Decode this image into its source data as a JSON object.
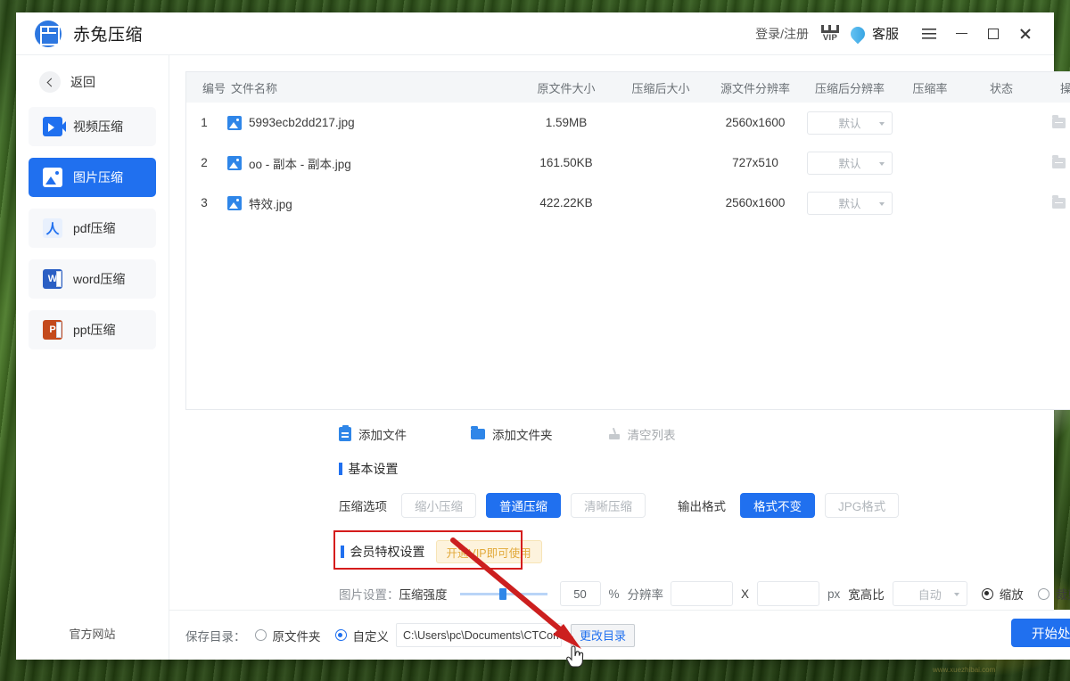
{
  "app": {
    "name": "赤兔压缩",
    "logo_icon": "grid-logo-icon"
  },
  "titlebar": {
    "login": "登录/注册",
    "vip_label": "VIP",
    "vip_icon": "crown-vip-icon",
    "support": "客服",
    "support_icon": "headset-drop-icon",
    "menu_icon": "hamburger-menu-icon",
    "minimize_icon": "minimize-icon",
    "maximize_icon": "maximize-icon",
    "close_icon": "close-icon"
  },
  "sidebar": {
    "back": "返回",
    "back_icon": "chevron-left-icon",
    "items": [
      {
        "label": "视频压缩",
        "icon": "video-icon",
        "active": false
      },
      {
        "label": "图片压缩",
        "icon": "image-icon",
        "active": true
      },
      {
        "label": "pdf压缩",
        "icon": "pdf-icon",
        "active": false
      },
      {
        "label": "word压缩",
        "icon": "word-icon",
        "active": false
      },
      {
        "label": "ppt压缩",
        "icon": "ppt-icon",
        "active": false
      }
    ],
    "site_link": "官方网站"
  },
  "filelist": {
    "columns": {
      "no": "编号",
      "name": "文件名称",
      "size": "原文件大小",
      "csize": "压缩后大小",
      "res": "源文件分辨率",
      "cres": "压缩后分辨率",
      "rate": "压缩率",
      "state": "状态",
      "action": "操作"
    },
    "rows": [
      {
        "no": "1",
        "name": "5993ecb2dd217.jpg",
        "size": "1.59MB",
        "csize": "",
        "res": "2560x1600",
        "cres": "默认",
        "rate": "",
        "state": ""
      },
      {
        "no": "2",
        "name": "oo - 副本 - 副本.jpg",
        "size": "161.50KB",
        "csize": "",
        "res": "727x510",
        "cres": "默认",
        "rate": "",
        "state": ""
      },
      {
        "no": "3",
        "name": "特效.jpg",
        "size": "422.22KB",
        "csize": "",
        "res": "2560x1600",
        "cres": "默认",
        "rate": "",
        "state": ""
      }
    ],
    "row_icons": {
      "file": "image-file-icon",
      "open_folder": "folder-icon",
      "remove": "remove-x-icon",
      "dropdown": "chevron-down-icon"
    }
  },
  "actionbar": {
    "add_file": "添加文件",
    "add_file_icon": "add-file-icon",
    "add_folder": "添加文件夹",
    "add_folder_icon": "add-folder-icon",
    "clear_list": "清空列表",
    "clear_list_icon": "broom-icon"
  },
  "basic_settings": {
    "section_title": "基本设置",
    "compress_option_label": "压缩选项",
    "compress_options": [
      {
        "label": "缩小压缩",
        "selected": false
      },
      {
        "label": "普通压缩",
        "selected": true
      },
      {
        "label": "清晰压缩",
        "selected": false
      }
    ],
    "output_format_label": "输出格式",
    "output_formats": [
      {
        "label": "格式不变",
        "selected": true
      },
      {
        "label": "JPG格式",
        "selected": false
      }
    ]
  },
  "vip_settings": {
    "section_title": "会员特权设置",
    "tag": "开通VIP即可使用",
    "highlighted": true,
    "highlight_color": "#d51c1c"
  },
  "image_settings": {
    "label": "图片设置：",
    "strength_label": "压缩强度",
    "strength_value": "50",
    "percent_unit": "%",
    "resolution_label": "分辨率",
    "res_width": "",
    "res_sep": "X",
    "res_height": "",
    "px_unit": "px",
    "aspect_label": "宽高比",
    "aspect_value": "自动",
    "aspect_icon": "chevron-down-icon",
    "modes": [
      {
        "label": "缩放",
        "selected": true
      },
      {
        "label": "裁剪",
        "selected": false
      }
    ]
  },
  "savebar": {
    "label": "保存目录：",
    "options": [
      {
        "label": "原文件夹",
        "selected": false
      },
      {
        "label": "自定义",
        "selected": true
      }
    ],
    "path": "C:\\Users\\pc\\Documents\\CTCom",
    "change_button": "更改目录",
    "start_button": "开始处理"
  },
  "annotation": {
    "arrow_color": "#cc1f1f",
    "box_color": "#d51c1c"
  },
  "colors": {
    "accent": "#2070ef",
    "panel": "#f4f6f8",
    "border": "#e7eaee",
    "muted": "#b2b7bc",
    "danger": "#e8332a",
    "vip_tag_bg": "#fdf3dd",
    "vip_tag_fg": "#e2a93a"
  }
}
